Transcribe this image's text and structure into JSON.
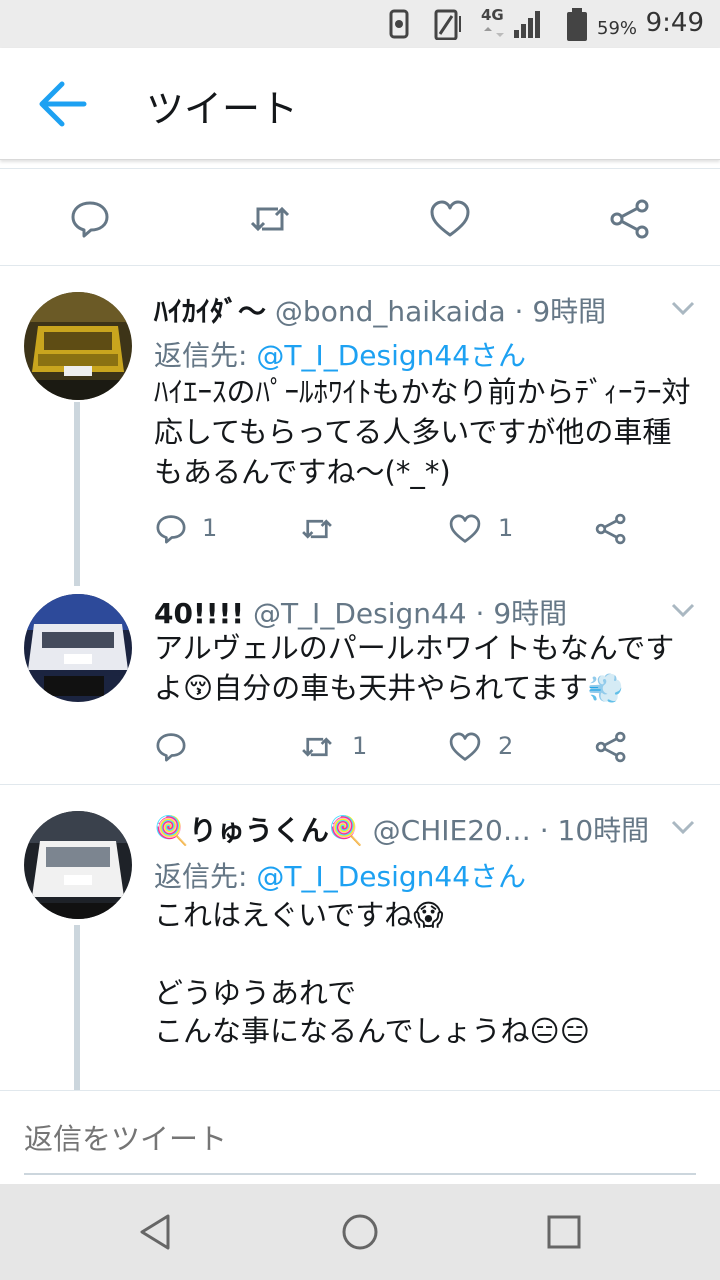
{
  "status_bar": {
    "network": "4G",
    "battery": "59%",
    "time": "9:49"
  },
  "app_bar": {
    "title": "ツイート"
  },
  "reply_box": {
    "placeholder": "返信をツイート"
  },
  "tweets": [
    {
      "name": "ﾊｲｶｲﾀﾞ〜",
      "handle": "@bond_haikaida",
      "time": "· 9時間",
      "reply_prefix": "返信先: ",
      "reply_to": "@T_I_Design44さん",
      "body": "ﾊｲｴｰｽのﾊﾟｰﾙﾎﾜｲﾄもかなり前からﾃﾞｨｰﾗｰ対応してもらってる人多いですが他の車種もあるんですね〜(*_*)",
      "replies": "1",
      "retweets": "",
      "likes": "1"
    },
    {
      "name": "40!!!!",
      "handle": "@T_I_Design44",
      "time": "· 9時間",
      "body": "アルヴェルのパールホワイトもなんですよ😚自分の車も天井やられてます💨",
      "replies": "",
      "retweets": "1",
      "likes": "2"
    },
    {
      "name": "🍭りゅうくん🍭",
      "handle": "@CHIE20…",
      "time": "· 10時間",
      "reply_prefix": "返信先: ",
      "reply_to": "@T_I_Design44さん",
      "body_line1": "これはえぐいですね😱",
      "body_line2": "どうゆうあれで",
      "body_line3": "こんな事になるんでしょうね😑😑"
    }
  ],
  "colors": {
    "accent": "#1da1f2",
    "muted": "#657786",
    "text": "#14171a"
  },
  "icons": [
    "back-arrow-icon",
    "reply-icon",
    "retweet-icon",
    "like-icon",
    "share-icon",
    "chevron-down-icon",
    "nav-back-icon",
    "nav-home-icon",
    "nav-recents-icon"
  ]
}
